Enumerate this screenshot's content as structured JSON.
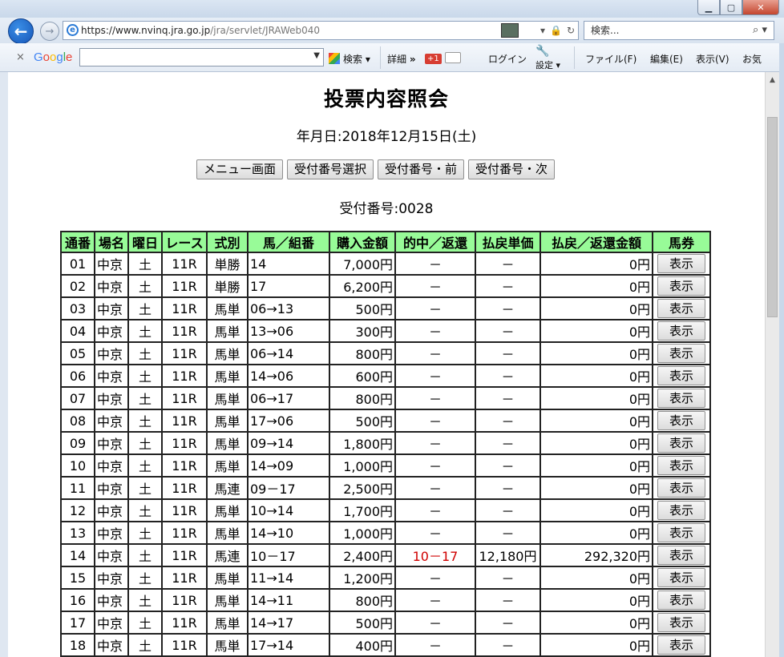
{
  "browser": {
    "url_main": "https://www.nvinq.jra.go.jp",
    "url_path": "/jra/servlet/JRAWeb040",
    "search_placeholder": "検索...",
    "toolbar": {
      "close": "×",
      "search_label": "検索",
      "details": "詳細",
      "more": "»",
      "gplus": "+1",
      "login": "ログイン",
      "settings": "設定",
      "menu_file": "ファイル(F)",
      "menu_edit": "編集(E)",
      "menu_view": "表示(V)",
      "menu_fav": "お気"
    }
  },
  "page": {
    "title": "投票内容照会",
    "date_line": "年月日:2018年12月15日(土)",
    "buttons": [
      "メニュー画面",
      "受付番号選択",
      "受付番号・前",
      "受付番号・次"
    ],
    "receipt_line": "受付番号:0028"
  },
  "table": {
    "headers": [
      "通番",
      "場名",
      "曜日",
      "レース",
      "式別",
      "馬／組番",
      "購入金額",
      "的中／返還",
      "払戻単価",
      "払戻／返還金額",
      "馬券"
    ],
    "show_label": "表示",
    "rows": [
      [
        "01",
        "中京",
        "土",
        "11R",
        "単勝",
        "14",
        "7,000円",
        "－",
        "－",
        "0円"
      ],
      [
        "02",
        "中京",
        "土",
        "11R",
        "単勝",
        "17",
        "6,200円",
        "－",
        "－",
        "0円"
      ],
      [
        "03",
        "中京",
        "土",
        "11R",
        "馬単",
        "06→13",
        "500円",
        "－",
        "－",
        "0円"
      ],
      [
        "04",
        "中京",
        "土",
        "11R",
        "馬単",
        "13→06",
        "300円",
        "－",
        "－",
        "0円"
      ],
      [
        "05",
        "中京",
        "土",
        "11R",
        "馬単",
        "06→14",
        "800円",
        "－",
        "－",
        "0円"
      ],
      [
        "06",
        "中京",
        "土",
        "11R",
        "馬単",
        "14→06",
        "600円",
        "－",
        "－",
        "0円"
      ],
      [
        "07",
        "中京",
        "土",
        "11R",
        "馬単",
        "06→17",
        "800円",
        "－",
        "－",
        "0円"
      ],
      [
        "08",
        "中京",
        "土",
        "11R",
        "馬単",
        "17→06",
        "500円",
        "－",
        "－",
        "0円"
      ],
      [
        "09",
        "中京",
        "土",
        "11R",
        "馬単",
        "09→14",
        "1,800円",
        "－",
        "－",
        "0円"
      ],
      [
        "10",
        "中京",
        "土",
        "11R",
        "馬単",
        "14→09",
        "1,000円",
        "－",
        "－",
        "0円"
      ],
      [
        "11",
        "中京",
        "土",
        "11R",
        "馬連",
        "09－17",
        "2,500円",
        "－",
        "－",
        "0円"
      ],
      [
        "12",
        "中京",
        "土",
        "11R",
        "馬単",
        "10→14",
        "1,700円",
        "－",
        "－",
        "0円"
      ],
      [
        "13",
        "中京",
        "土",
        "11R",
        "馬単",
        "14→10",
        "1,000円",
        "－",
        "－",
        "0円"
      ],
      [
        "14",
        "中京",
        "土",
        "11R",
        "馬連",
        "10－17",
        "2,400円",
        "10－17",
        "12,180円",
        "292,320円"
      ],
      [
        "15",
        "中京",
        "土",
        "11R",
        "馬単",
        "11→14",
        "1,200円",
        "－",
        "－",
        "0円"
      ],
      [
        "16",
        "中京",
        "土",
        "11R",
        "馬単",
        "14→11",
        "800円",
        "－",
        "－",
        "0円"
      ],
      [
        "17",
        "中京",
        "土",
        "11R",
        "馬単",
        "14→17",
        "500円",
        "－",
        "－",
        "0円"
      ],
      [
        "18",
        "中京",
        "土",
        "11R",
        "馬単",
        "17→14",
        "400円",
        "－",
        "－",
        "0円"
      ]
    ]
  }
}
